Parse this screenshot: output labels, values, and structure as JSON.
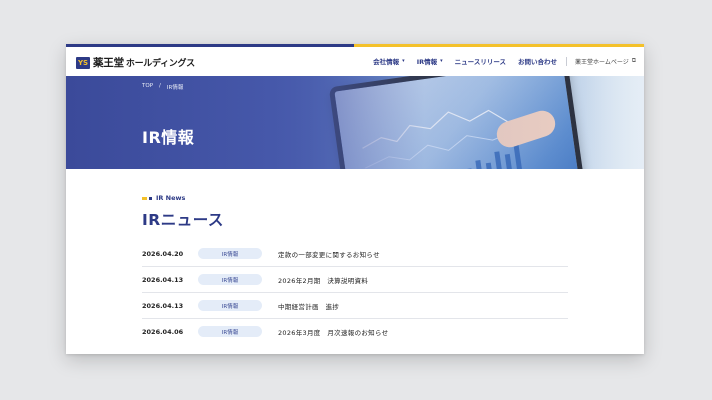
{
  "header": {
    "logo_badge": "YS",
    "logo_name": "薬王堂",
    "logo_sub": "ホールディングス",
    "nav": [
      {
        "label": "会社情報",
        "chevron": true
      },
      {
        "label": "IR情報",
        "chevron": true
      },
      {
        "label": "ニュースリリース",
        "chevron": false
      },
      {
        "label": "お問い合わせ",
        "chevron": false
      }
    ],
    "external_link": "薬王堂ホームページ",
    "chevron_glyph": "▾",
    "external_icon_glyph": "⧉"
  },
  "hero": {
    "breadcrumb": [
      "TOP",
      "/",
      "IR情報"
    ],
    "title": "IR情報"
  },
  "section": {
    "label": "IR News",
    "title": "IRニュース"
  },
  "news": [
    {
      "date": "2026.04.20",
      "category": "IR情報",
      "title": "定款の一部変更に関するお知らせ"
    },
    {
      "date": "2026.04.13",
      "category": "IR情報",
      "title": "2026年2月期　決算説明資料"
    },
    {
      "date": "2026.04.13",
      "category": "IR情報",
      "title": "中期経営計画　進捗"
    },
    {
      "date": "2026.04.06",
      "category": "IR情報",
      "title": "2026年3月度　月次速報のお知らせ"
    }
  ],
  "colors": {
    "brand_navy": "#2d3a86",
    "brand_yellow": "#f4c12a",
    "badge_bg": "#e4ecf8"
  },
  "icons": {
    "chevron": "chevron-down-icon",
    "external": "external-link-icon"
  }
}
